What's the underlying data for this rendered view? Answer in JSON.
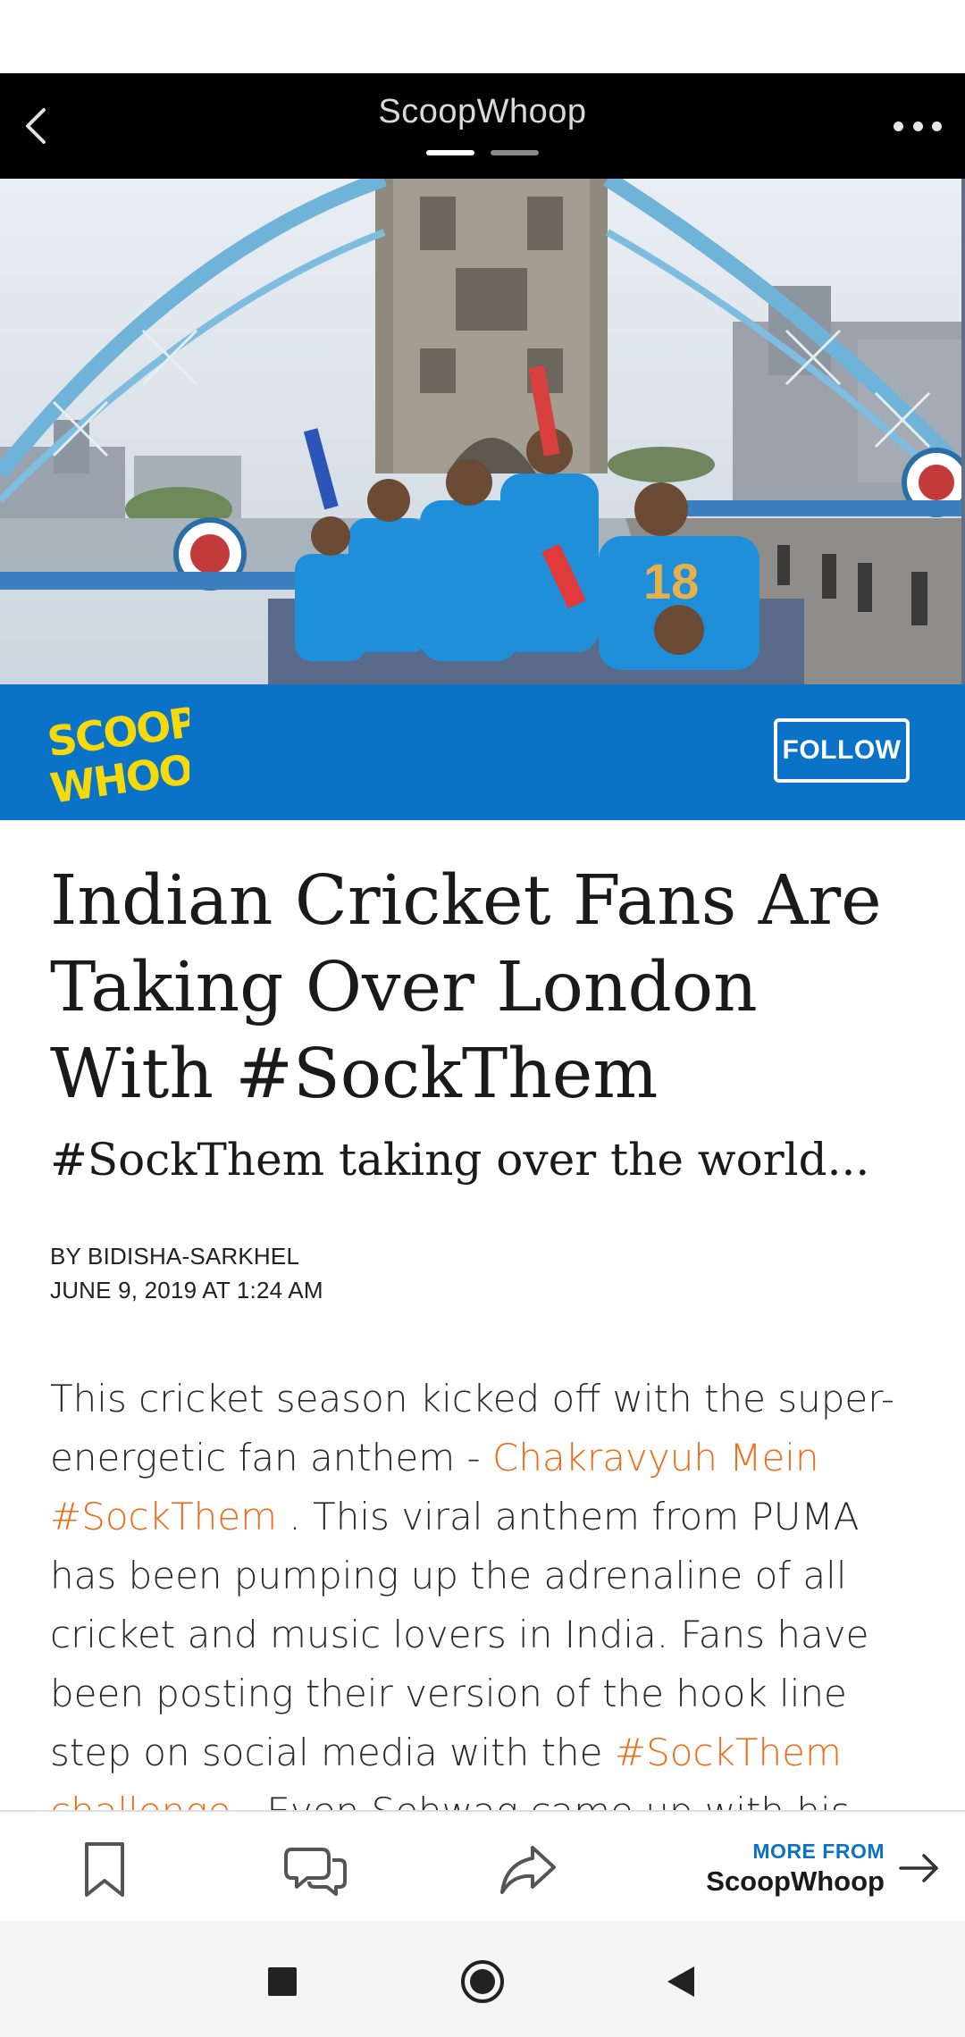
{
  "header": {
    "title": "ScoopWhoop",
    "back_icon": "chevron-left-icon",
    "more_icon": "more-horizontal-icon",
    "page_indicator": {
      "count": 2,
      "active_index": 0
    }
  },
  "hero": {
    "description_icon": "hero-photo"
  },
  "publisher": {
    "logo_text": "SCOOP WHOOP",
    "follow_label": "FOLLOW",
    "band_color": "#0a72c7",
    "logo_color": "#f5d90a"
  },
  "article": {
    "headline": "Indian Cricket Fans Are Taking Over London With #SockThem",
    "subheadline": "#SockThem taking over the world...",
    "byline": "BY BIDISHA-SARKHEL",
    "date": "JUNE 9, 2019 AT 1:24 AM",
    "body": {
      "part1": "This cricket season kicked off with the super-energetic fan anthem - ",
      "link1": "Chakravyuh Mein #SockThem",
      "part2": " . This viral anthem from PUMA has been pumping up the adrenaline of all cricket and music lovers in India. Fans have been posting their version of the hook line step on social media with the ",
      "link2": "#SockThem challenge",
      "part3": " . Even Sehwag came up with his"
    },
    "link_color": "#ef6c1a"
  },
  "action_bar": {
    "bookmark_icon": "bookmark-icon",
    "comment_icon": "comment-icon",
    "share_icon": "share-icon",
    "more_from_label": "MORE FROM",
    "more_from_name": "ScoopWhoop",
    "arrow_icon": "arrow-right-icon"
  },
  "nav": {
    "recents_icon": "square-icon",
    "home_icon": "circle-icon",
    "back_icon": "triangle-back-icon"
  }
}
